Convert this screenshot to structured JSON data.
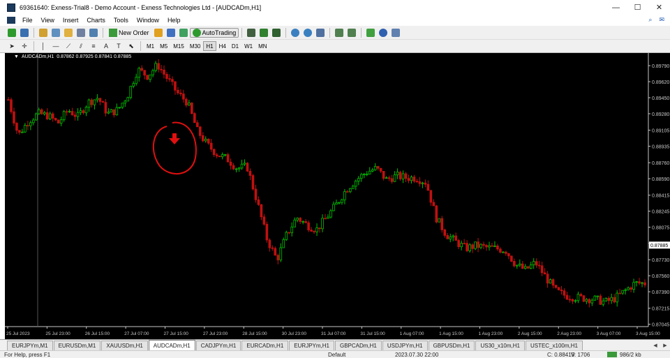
{
  "window": {
    "title": "69361640: Exness-Trial8 - Demo Account - Exness Technologies Ltd - [AUDCADm,H1]",
    "minimize": "—",
    "maximize": "☐",
    "close": "✕"
  },
  "menu": {
    "items": [
      "File",
      "View",
      "Insert",
      "Charts",
      "Tools",
      "Window",
      "Help"
    ]
  },
  "toolbar": {
    "new_order": "New Order",
    "auto_trading": "AutoTrading",
    "timeframes": [
      "M1",
      "M5",
      "M15",
      "M30",
      "H1",
      "H4",
      "D1",
      "W1",
      "MN"
    ],
    "active_timeframe": "H1"
  },
  "chart": {
    "symbol_info": "AUDCADm,H1",
    "ohlc": "0.87862 0.87925 0.87841 0.87885",
    "bull_color": "#00c000",
    "bear_color": "#c01010",
    "background": "#000000"
  },
  "chart_data": {
    "type": "candlestick",
    "y_ticks": [
      "0.89790",
      "0.89620",
      "0.89450",
      "0.89280",
      "0.89105",
      "0.88935",
      "0.88760",
      "0.88590",
      "0.88415",
      "0.88245",
      "0.88075",
      "0.87905",
      "0.87730",
      "0.87560",
      "0.87390",
      "0.87215",
      "0.87045"
    ],
    "current_price": "0.87885",
    "x_ticks": [
      "25 Jul 2023",
      "25 Jul 23:00",
      "26 Jul 15:00",
      "27 Jul 07:00",
      "27 Jul 15:00",
      "27 Jul 23:00",
      "28 Jul 15:00",
      "30 Jul 23:00",
      "31 Jul 07:00",
      "31 Jul 15:00",
      "1 Aug 07:00",
      "1 Aug 15:00",
      "1 Aug 23:00",
      "2 Aug 15:00",
      "2 Aug 23:00",
      "3 Aug 07:00",
      "3 Aug 15:00"
    ],
    "ylim": [
      0.8702,
      0.8985
    ],
    "close_path": [
      0.8943,
      0.8905,
      0.892,
      0.8928,
      0.8926,
      0.8918,
      0.8932,
      0.8925,
      0.894,
      0.8945,
      0.8928,
      0.8932,
      0.8948,
      0.8975,
      0.8968,
      0.898,
      0.8965,
      0.895,
      0.894,
      0.891,
      0.8895,
      0.8885,
      0.888,
      0.887,
      0.8872,
      0.8835,
      0.8795,
      0.8773,
      0.88,
      0.8818,
      0.881,
      0.8805,
      0.8818,
      0.8832,
      0.8848,
      0.8858,
      0.8866,
      0.887,
      0.8858,
      0.8862,
      0.886,
      0.886,
      0.8855,
      0.8818,
      0.88,
      0.8792,
      0.8785,
      0.8788,
      0.8786,
      0.8785,
      0.8783,
      0.8768,
      0.8762,
      0.877,
      0.8755,
      0.874,
      0.8735,
      0.8733,
      0.8732,
      0.8731,
      0.8728,
      0.8732,
      0.874,
      0.8748,
      0.8748
    ],
    "annotation": "circle-with-down-arrow"
  },
  "tabs": [
    "EURJPYm,M1",
    "EURUSDm,M1",
    "XAUUSDm,H1",
    "AUDCADm,H1",
    "CADJPYm,H1",
    "EURCADm,H1",
    "EURJPYm,H1",
    "GBPCADm,H1",
    "USDJPYm,H1",
    "GBPUSDm,H1",
    "US30_x10m,H1",
    "USTEC_x100m,H1"
  ],
  "active_tab": "AUDCADm,H1",
  "status": {
    "help": "For Help, press F1",
    "profile": "Default",
    "datetime": "2023.07.30 22:00",
    "close": "C: 0.88419",
    "volume": "V: 1706",
    "traffic": "986/2 kb"
  }
}
